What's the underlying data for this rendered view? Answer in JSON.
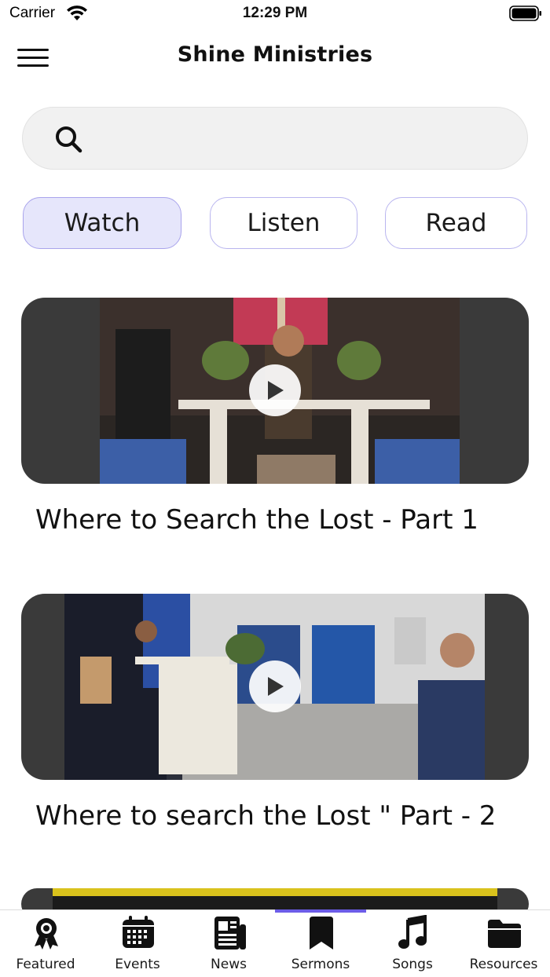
{
  "status_bar": {
    "carrier": "Carrier",
    "time": "12:29 PM"
  },
  "header": {
    "title": "Shine Ministries"
  },
  "search": {
    "placeholder": "",
    "value": ""
  },
  "segments": [
    {
      "label": "Watch",
      "active": true
    },
    {
      "label": "Listen",
      "active": false
    },
    {
      "label": "Read",
      "active": false
    }
  ],
  "videos": [
    {
      "title": "Where to Search the Lost - Part 1"
    },
    {
      "title": "Where to search the Lost \" Part - 2"
    }
  ],
  "tabbar": {
    "items": [
      {
        "label": "Featured",
        "icon": "award-ribbon-icon"
      },
      {
        "label": "Events",
        "icon": "calendar-icon"
      },
      {
        "label": "News",
        "icon": "newspaper-icon"
      },
      {
        "label": "Sermons",
        "icon": "bookmark-icon",
        "active": true
      },
      {
        "label": "Songs",
        "icon": "music-note-icon"
      },
      {
        "label": "Resources",
        "icon": "folder-icon"
      }
    ]
  },
  "colors": {
    "accent": "#6c5ce7",
    "active_tab_bg": "#e6e6fb",
    "tab_border": "#b9b5ef"
  }
}
